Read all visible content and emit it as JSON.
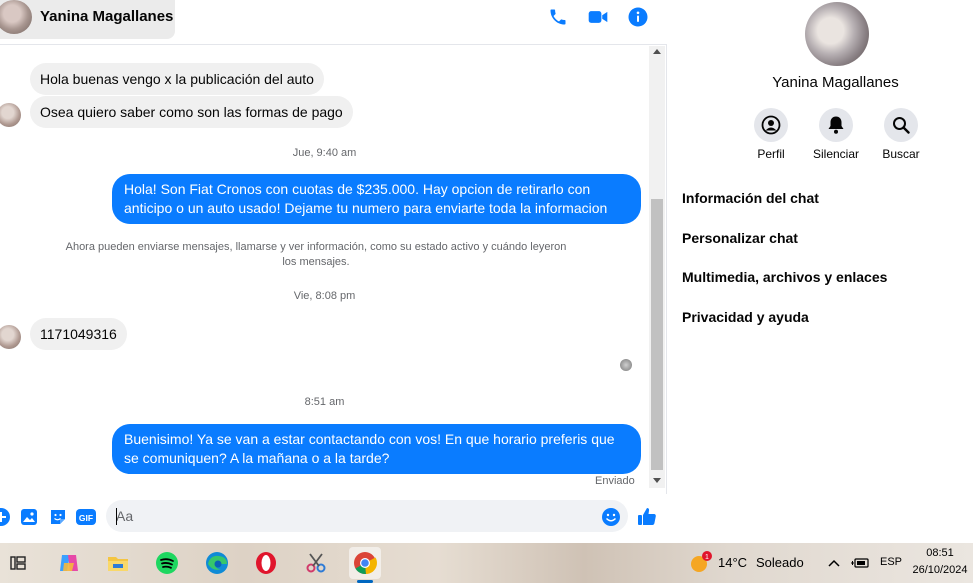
{
  "colors": {
    "accent": "#0a7cff",
    "incoming_bubble": "#f0f0f0",
    "header_icons": "#0a7cff"
  },
  "header": {
    "contact_name": "Yanina Magallanes",
    "icons": [
      "phone-icon",
      "video-call-icon",
      "info-icon"
    ]
  },
  "messages": [
    {
      "type": "incoming",
      "text": "Hola buenas vengo x la publicación del auto"
    },
    {
      "type": "incoming",
      "text": "Osea quiero saber como son las formas de pago"
    },
    {
      "type": "timestamp",
      "text": "Jue, 9:40 am"
    },
    {
      "type": "outgoing",
      "text": "Hola! Son Fiat Cronos con cuotas de $235.000. Hay opcion de retirarlo con anticipo o un auto usado! Dejame tu numero para enviarte toda la informacion"
    },
    {
      "type": "notice",
      "text": "Ahora pueden enviarse mensajes, llamarse y ver información, como su estado activo y cuándo leyeron los mensajes."
    },
    {
      "type": "timestamp",
      "text": "Vie, 8:08 pm"
    },
    {
      "type": "incoming",
      "text": "1171049316"
    },
    {
      "type": "timestamp",
      "text": "8:51 am"
    },
    {
      "type": "outgoing",
      "text": "Buenisimo! Ya se van a estar contactando con vos! En que horario preferis que se comuniquen? A la mañana o a la tarde?"
    }
  ],
  "sent_status": "Enviado",
  "composer": {
    "placeholder": "Aa",
    "icons": [
      "add-icon",
      "image-icon",
      "sticker-icon",
      "gif-icon",
      "emoji-icon",
      "like-icon"
    ],
    "gif_label": "GIF"
  },
  "info_panel": {
    "name": "Yanina Magallanes",
    "actions": [
      {
        "label": "Perfil",
        "icon": "profile-icon"
      },
      {
        "label": "Silenciar",
        "icon": "bell-icon"
      },
      {
        "label": "Buscar",
        "icon": "search-icon"
      }
    ],
    "menu": [
      "Información del chat",
      "Personalizar chat",
      "Multimedia, archivos y enlaces",
      "Privacidad y ayuda"
    ]
  },
  "taskbar": {
    "apps": [
      "task-view-icon",
      "copilot-icon",
      "file-explorer-icon",
      "spotify-icon",
      "edge-icon",
      "opera-icon",
      "snipping-icon",
      "chrome-icon"
    ],
    "weather": {
      "temp": "14°C",
      "condition": "Soleado",
      "badge": "1"
    },
    "language": "ESP",
    "time": "08:51",
    "date": "26/10/2024"
  }
}
